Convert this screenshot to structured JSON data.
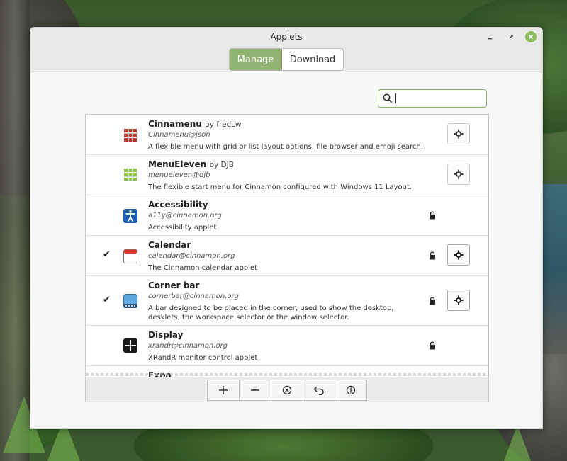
{
  "window": {
    "title": "Applets",
    "controls": {
      "minimize": "minimize-icon",
      "maximize": "maximize-icon",
      "close": "close-icon"
    }
  },
  "tabs": [
    {
      "label": "Manage",
      "active": true
    },
    {
      "label": "Download",
      "active": false
    }
  ],
  "search": {
    "value": "",
    "icon": "search-icon"
  },
  "applets": [
    {
      "name": "Cinnamenu",
      "author": "by fredcw",
      "uuid": "Cinnamenu@json",
      "description": "A flexible menu with grid or list layout options, file browser and emoji search.",
      "enabled": false,
      "locked": false,
      "configurable": true,
      "icon": "grid-icon-red"
    },
    {
      "name": "MenuEleven",
      "author": "by DJB",
      "uuid": "menueleven@djb",
      "description": "The flexible start menu for Cinnamon configured with Windows 11 Layout.",
      "enabled": false,
      "locked": false,
      "configurable": true,
      "icon": "grid-icon-green"
    },
    {
      "name": "Accessibility",
      "author": "",
      "uuid": "a11y@cinnamon.org",
      "description": "Accessibility applet",
      "enabled": false,
      "locked": true,
      "configurable": false,
      "icon": "accessibility-icon"
    },
    {
      "name": "Calendar",
      "author": "",
      "uuid": "calendar@cinnamon.org",
      "description": "The Cinnamon calendar applet",
      "enabled": true,
      "locked": true,
      "configurable": true,
      "icon": "calendar-icon"
    },
    {
      "name": "Corner bar",
      "author": "",
      "uuid": "cornerbar@cinnamon.org",
      "description": "A bar designed to be placed in the corner, used to show the desktop, desklets, the workspace selector or the window selector.",
      "enabled": true,
      "locked": true,
      "configurable": true,
      "icon": "cornerbar-icon"
    },
    {
      "name": "Display",
      "author": "",
      "uuid": "xrandr@cinnamon.org",
      "description": "XRandR monitor control applet",
      "enabled": false,
      "locked": true,
      "configurable": false,
      "icon": "display-icon"
    },
    {
      "name": "Expo",
      "author": "",
      "uuid": "",
      "description": "",
      "enabled": false,
      "locked": false,
      "configurable": false,
      "icon": ""
    }
  ],
  "toolbar": {
    "buttons": [
      {
        "name": "add",
        "icon": "plus-icon"
      },
      {
        "name": "remove",
        "icon": "minus-icon"
      },
      {
        "name": "disable",
        "icon": "circle-x-icon"
      },
      {
        "name": "restore",
        "icon": "undo-arrow-icon"
      },
      {
        "name": "about",
        "icon": "info-icon"
      }
    ]
  },
  "colors": {
    "accent": "#92b372",
    "close": "#8fbf5f"
  }
}
